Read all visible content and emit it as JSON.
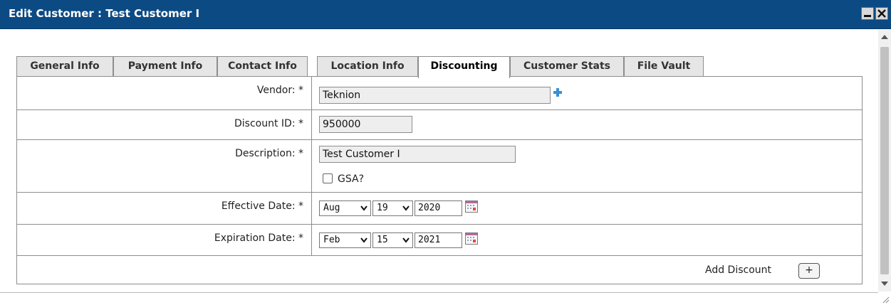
{
  "window": {
    "title": "Edit Customer : Test Customer I"
  },
  "tabs": [
    {
      "label": "General Info",
      "active": false
    },
    {
      "label": "Payment Info",
      "active": false
    },
    {
      "label": "Contact Info",
      "active": false
    },
    {
      "label": "Location Info",
      "active": false
    },
    {
      "label": "Discounting",
      "active": true
    },
    {
      "label": "Customer Stats",
      "active": false
    },
    {
      "label": "File Vault",
      "active": false
    }
  ],
  "form": {
    "vendor": {
      "label": "Vendor: *",
      "value": "Teknion"
    },
    "discount_id": {
      "label": "Discount ID: *",
      "value": "950000"
    },
    "description": {
      "label": "Description: *",
      "value": "Test Customer I"
    },
    "gsa": {
      "label": "GSA?",
      "checked": false
    },
    "effective_date": {
      "label": "Effective Date: *",
      "month": "Aug",
      "day": "19",
      "year": "2020"
    },
    "expiration_date": {
      "label": "Expiration Date: *",
      "month": "Feb",
      "day": "15",
      "year": "2021"
    }
  },
  "actions": {
    "add_discount_label": "Add Discount",
    "add_discount_button": "+"
  },
  "colors": {
    "titlebar": "#0c4a84",
    "plus_icon": "#3a8fd6"
  }
}
